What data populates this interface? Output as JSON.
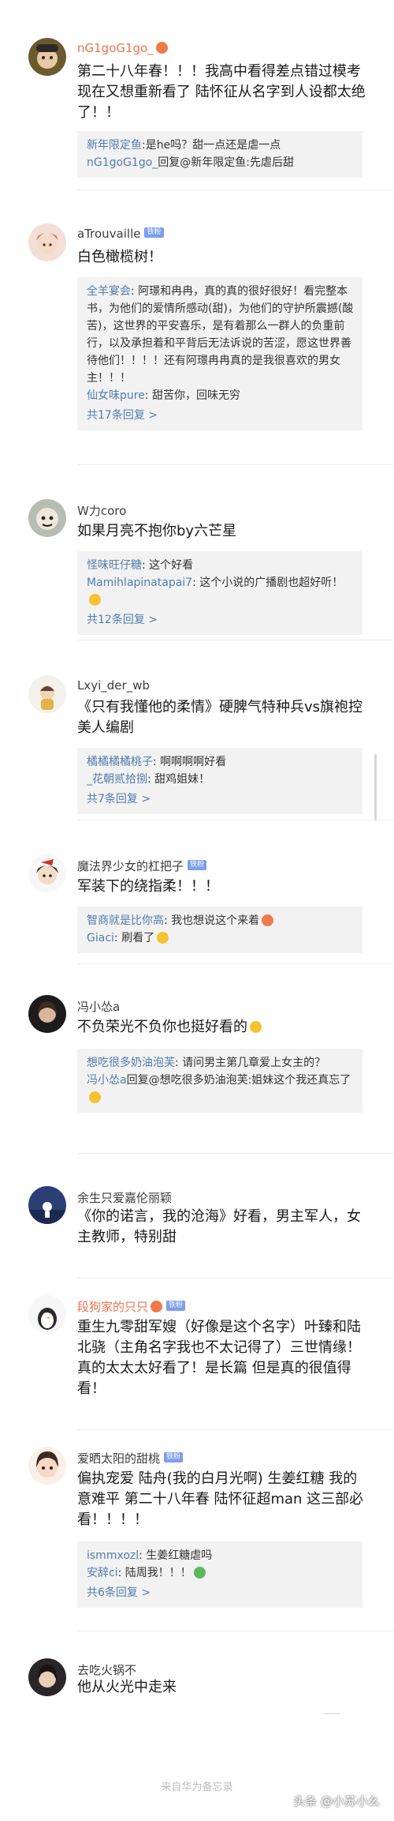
{
  "comments": [
    {
      "username": "nG1goG1go_",
      "text": "第二十八年春！！！我高中看得差点错过模考 现在又想重新看了 陆怀征从名字到人设都太绝了！！",
      "replies": [
        {
          "name": "新年限定鱼",
          "text": ":是he吗？甜一点还是虐一点"
        },
        {
          "name": "nG1goG1go_",
          "text": "回复@新年限定鱼:先虐后甜"
        }
      ]
    },
    {
      "username": "aTrouvaille",
      "badge": "铁粉",
      "text": "白色橄榄树！",
      "replies": [
        {
          "name": "全羊宴会",
          "text": ": 阿璟和冉冉，真的真的很好很好！看完整本书，为他们的爱情所感动(甜)，为他们的守护所震撼(酸苦)，这世界的平安喜乐，是有着那么一群人的负重前行，以及承担着和平背后无法诉说的苦涩，愿这世界善待他们！！！！还有阿璟冉冉真的是我很喜欢的男女主！！！"
        },
        {
          "name": "仙女味pure",
          "text": ": 甜苦你，回味无穷"
        }
      ],
      "more": "共17条回复 >"
    },
    {
      "username": "W力coro",
      "text": "如果月亮不抱你by六芒星",
      "replies": [
        {
          "name": "怪味旺仔糖",
          "text": ": 这个好看"
        },
        {
          "name": "Mamihlapinatapai7",
          "text": ": 这个小说的广播剧也超好听！"
        }
      ],
      "more": "共12条回复 >"
    },
    {
      "username": "Lxyi_der_wb",
      "text": "《只有我懂他的柔情》硬脾气特种兵vs旗袍控美人编剧",
      "replies": [
        {
          "name": "橘橘橘橘桃子",
          "text": ": 啊啊啊啊好看"
        },
        {
          "name": "_花朝贰拾捌",
          "text": ": 甜鸡姐妹！"
        }
      ],
      "more": "共7条回复 >"
    },
    {
      "username": "魔法界少女的杠把子",
      "badge": "铁粉",
      "text": "军装下的绕指柔！！！",
      "replies": [
        {
          "name": "智商就是比你高",
          "text": ": 我也想说这个来着"
        },
        {
          "name": "Giaci",
          "text": ": 刷看了"
        }
      ]
    },
    {
      "username": "冯小怂a",
      "text": "不负荣光不负你也挺好看的",
      "replies": [
        {
          "name": "想吃很多奶油泡芙",
          "text": ": 请问男主第几章爱上女主的？"
        },
        {
          "name": "冯小怂a",
          "text": "回复@想吃很多奶油泡芙:姐妹这个我还真忘了"
        }
      ]
    },
    {
      "username": "余生只爱嘉伦丽颖",
      "text": "《你的诺言，我的沧海》好看，男主军人，女主教师，特别甜"
    },
    {
      "username": "段狗家的只只",
      "badge": "铁粉",
      "text": "重生九零甜军嫂（好像是这个名字）叶臻和陆北骁（主角名字我也不太记得了）三世情缘！真的太太太好看了！是长篇 但是真的很值得看！"
    },
    {
      "username": "爱晒太阳的甜桃",
      "badge": "铁粉",
      "text": "偏执宠爱 陆舟(我的白月光啊) 生姜红糖 我的意难平 第二十八年春 陆怀征超man 这三部必看！！！！",
      "replies": [
        {
          "name": "ismmxozl",
          "text": ": 生姜红糖虐吗"
        },
        {
          "name": "安辞ci",
          "text": ": 陆周我！！！"
        }
      ],
      "more": "共6条回复 >"
    },
    {
      "username": "去吃火锅不",
      "text": "他从火光中走来"
    }
  ],
  "footer": "来自华为备忘录",
  "watermark": "头条 @小苏小幺",
  "colors": {
    "link": "#507daf",
    "orange_name": "#eb7350",
    "reply_bg": "#f2f2f2",
    "badge": "#7c9ef0"
  },
  "icons": [
    "avatar-image",
    "emoji-icon"
  ]
}
